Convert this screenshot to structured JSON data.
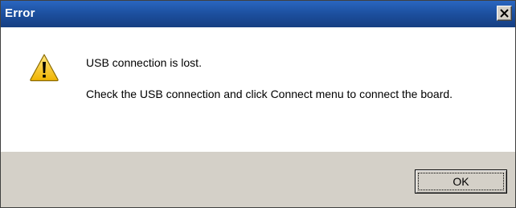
{
  "window": {
    "title": "Error"
  },
  "message": {
    "line1": "USB connection is lost.",
    "line2": "Check the USB connection and click Connect menu to connect the board."
  },
  "buttons": {
    "ok_label": "OK"
  },
  "icons": {
    "message_icon": "warning-icon",
    "close_icon": "close-icon"
  },
  "colors": {
    "titlebar": "#1c4f9e",
    "footer": "#d4d0c8",
    "warning": "#f5c400"
  }
}
